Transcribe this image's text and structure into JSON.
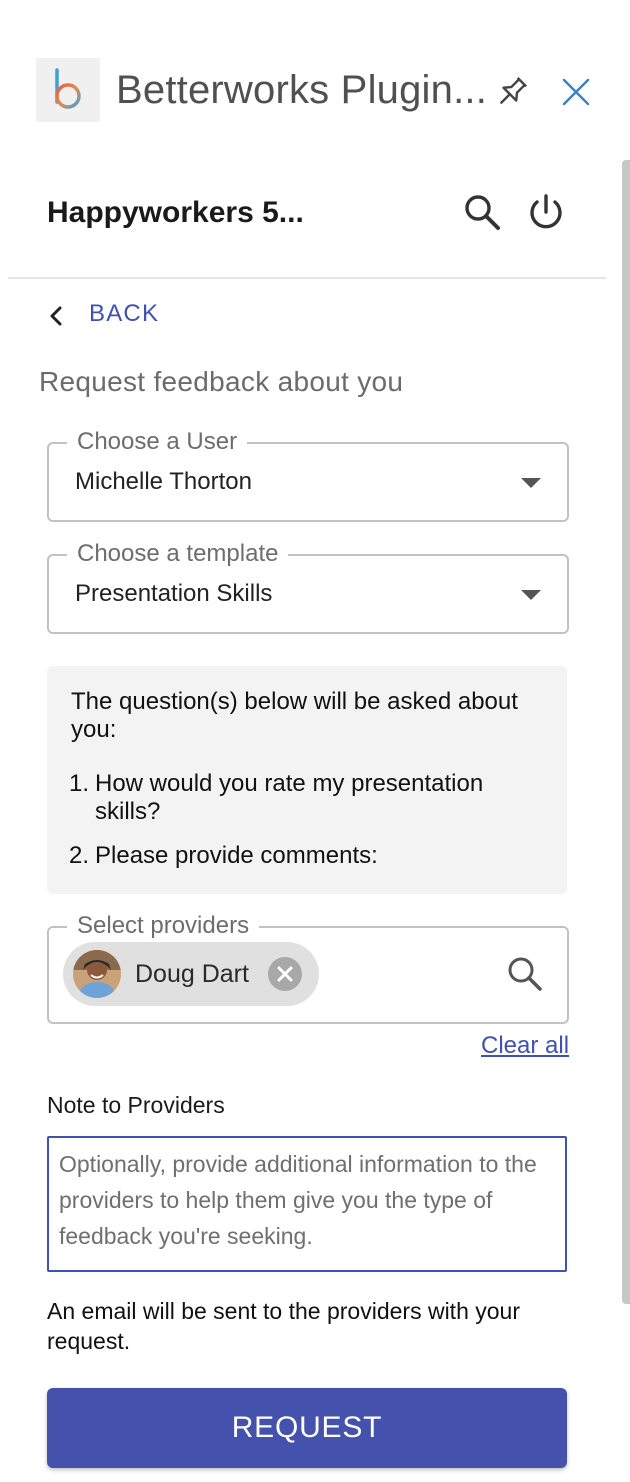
{
  "window": {
    "title": "Betterworks Plugin...",
    "logo_icon": "betterworks-b-logo",
    "pin_icon": "pin-icon",
    "close_icon": "close-icon"
  },
  "header": {
    "company": "Happyworkers 5...",
    "search_icon": "search-icon",
    "power_icon": "power-icon"
  },
  "back": {
    "label": "BACK"
  },
  "page": {
    "title": "Request feedback about you"
  },
  "user_select": {
    "label": "Choose a User",
    "value": "Michelle Thorton"
  },
  "template_select": {
    "label": "Choose a template",
    "value": "Presentation Skills"
  },
  "questions": {
    "intro": "The question(s) below will be asked about you:",
    "items": [
      {
        "num": "1.",
        "text": "How would you rate my presentation skills?"
      },
      {
        "num": "2.",
        "text": "Please provide comments:"
      }
    ]
  },
  "providers": {
    "label": "Select providers",
    "chips": [
      {
        "name": "Doug Dart"
      }
    ],
    "clear_label": "Clear all"
  },
  "note": {
    "label": "Note to Providers",
    "placeholder": "Optionally, provide additional information to the providers to help them give you the type of feedback you're seeking."
  },
  "email_notice": "An email will be sent to the providers with your request.",
  "request_button": "REQUEST",
  "colors": {
    "accent": "#3f51b5",
    "button": "#4451ad"
  }
}
